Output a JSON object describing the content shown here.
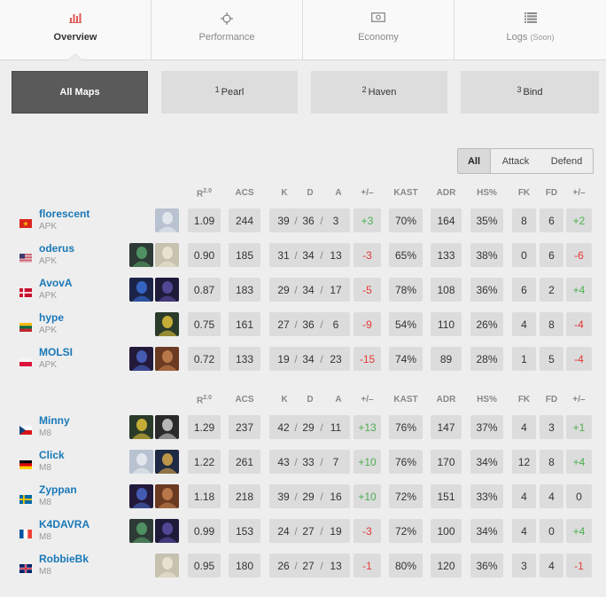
{
  "tabs": [
    {
      "label": "Overview",
      "icon": "bar-chart-icon",
      "active": true
    },
    {
      "label": "Performance",
      "icon": "crosshair-icon",
      "active": false
    },
    {
      "label": "Economy",
      "icon": "cash-icon",
      "active": false
    },
    {
      "label": "Logs",
      "soon": "(Soon)",
      "icon": "list-icon",
      "active": false
    }
  ],
  "maps": [
    {
      "num": "",
      "label": "All Maps",
      "active": true
    },
    {
      "num": "1",
      "label": "Pearl",
      "active": false
    },
    {
      "num": "2",
      "label": "Haven",
      "active": false
    },
    {
      "num": "3",
      "label": "Bind",
      "active": false
    }
  ],
  "side_filter": [
    "All",
    "Attack",
    "Defend"
  ],
  "headers": {
    "rating": "R",
    "rating_sup": "2.0",
    "acs": "ACS",
    "k": "K",
    "d": "D",
    "a": "A",
    "diff": "+/–",
    "kast": "KAST",
    "adr": "ADR",
    "hs": "HS%",
    "fk": "FK",
    "fd": "FD",
    "fkdiff": "+/–"
  },
  "teams": [
    {
      "players": [
        {
          "name": "florescent",
          "team": "APK",
          "flag": "vn",
          "agents": [
            "jett"
          ],
          "rating": "1.09",
          "acs": "244",
          "k": "39",
          "d": "36",
          "a": "3",
          "diff": "+3",
          "kast": "70%",
          "adr": "164",
          "hs": "35%",
          "fk": "8",
          "fd": "6",
          "fkdiff": "+2"
        },
        {
          "name": "oderus",
          "team": "APK",
          "flag": "us",
          "agents": [
            "viper",
            "sage"
          ],
          "rating": "0.90",
          "acs": "185",
          "k": "31",
          "d": "34",
          "a": "13",
          "diff": "-3",
          "kast": "65%",
          "adr": "133",
          "hs": "38%",
          "fk": "0",
          "fd": "6",
          "fkdiff": "-6"
        },
        {
          "name": "AvovA",
          "team": "APK",
          "flag": "dk",
          "agents": [
            "neon",
            "omen"
          ],
          "rating": "0.87",
          "acs": "183",
          "k": "29",
          "d": "34",
          "a": "17",
          "diff": "-5",
          "kast": "78%",
          "adr": "108",
          "hs": "36%",
          "fk": "6",
          "fd": "2",
          "fkdiff": "+4"
        },
        {
          "name": "hype",
          "team": "APK",
          "flag": "lt",
          "agents": [
            "killjoy"
          ],
          "rating": "0.75",
          "acs": "161",
          "k": "27",
          "d": "36",
          "a": "6",
          "diff": "-9",
          "kast": "54%",
          "adr": "110",
          "hs": "26%",
          "fk": "4",
          "fd": "8",
          "fkdiff": "-4"
        },
        {
          "name": "MOLSI",
          "team": "APK",
          "flag": "pl",
          "agents": [
            "astra",
            "breach"
          ],
          "rating": "0.72",
          "acs": "133",
          "k": "19",
          "d": "34",
          "a": "23",
          "diff": "-15",
          "kast": "74%",
          "adr": "89",
          "hs": "28%",
          "fk": "1",
          "fd": "5",
          "fkdiff": "-4"
        }
      ]
    },
    {
      "players": [
        {
          "name": "Minny",
          "team": "M8",
          "flag": "cz",
          "agents": [
            "killjoy",
            "cypher"
          ],
          "rating": "1.29",
          "acs": "237",
          "k": "42",
          "d": "29",
          "a": "11",
          "diff": "+13",
          "kast": "76%",
          "adr": "147",
          "hs": "37%",
          "fk": "4",
          "fd": "3",
          "fkdiff": "+1"
        },
        {
          "name": "Click",
          "team": "M8",
          "flag": "de",
          "agents": [
            "jett",
            "chamber"
          ],
          "rating": "1.22",
          "acs": "261",
          "k": "43",
          "d": "33",
          "a": "7",
          "diff": "+10",
          "kast": "76%",
          "adr": "170",
          "hs": "34%",
          "fk": "12",
          "fd": "8",
          "fkdiff": "+4"
        },
        {
          "name": "Zyppan",
          "team": "M8",
          "flag": "se",
          "agents": [
            "astra",
            "breach"
          ],
          "rating": "1.18",
          "acs": "218",
          "k": "39",
          "d": "29",
          "a": "16",
          "diff": "+10",
          "kast": "72%",
          "adr": "151",
          "hs": "33%",
          "fk": "4",
          "fd": "4",
          "fkdiff": "0"
        },
        {
          "name": "K4DAVRA",
          "team": "M8",
          "flag": "fr",
          "agents": [
            "viper",
            "omen"
          ],
          "rating": "0.99",
          "acs": "153",
          "k": "24",
          "d": "27",
          "a": "19",
          "diff": "-3",
          "kast": "72%",
          "adr": "100",
          "hs": "34%",
          "fk": "4",
          "fd": "0",
          "fkdiff": "+4"
        },
        {
          "name": "RobbieBk",
          "team": "M8",
          "flag": "gb",
          "agents": [
            "sage"
          ],
          "rating": "0.95",
          "acs": "180",
          "k": "26",
          "d": "27",
          "a": "13",
          "diff": "-1",
          "kast": "80%",
          "adr": "120",
          "hs": "36%",
          "fk": "3",
          "fd": "4",
          "fkdiff": "-1"
        }
      ]
    }
  ],
  "colors": {
    "positive": "#4caf50",
    "negative": "#e53935",
    "link": "#1a78b8",
    "active_map": "#5a5a5a"
  }
}
